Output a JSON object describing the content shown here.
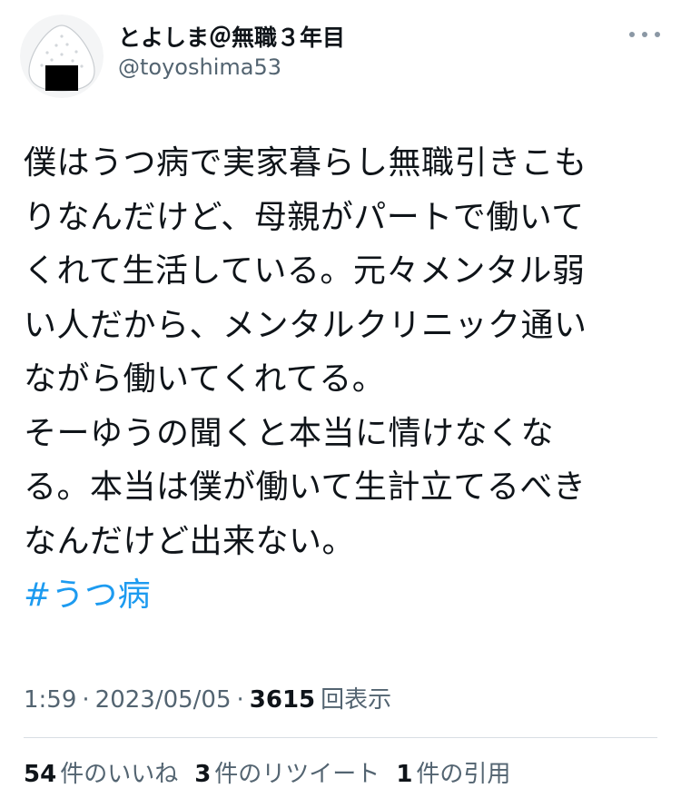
{
  "user": {
    "display_name": "とよしま＠無職３年目",
    "handle": "@toyoshima53",
    "avatar_icon": "onigiri-avatar-icon"
  },
  "tweet": {
    "lines": [
      "僕はうつ病で実家暮らし無職引きこも",
      "りなんだけど、母親がパートで働いて",
      "くれて生活している。元々メンタル弱",
      "い人だから、メンタルクリニック通い",
      "ながら働いてくれてる。",
      "そーゆうの聞くと本当に情けなくな",
      "る。本当は僕が働いて生計立てるべき",
      "なんだけど出来ない。"
    ],
    "hashtag": "#うつ病"
  },
  "meta": {
    "time": "1:59",
    "separator": "·",
    "date": "2023/05/05",
    "views_count": "3615",
    "views_label": "回表示"
  },
  "stats": {
    "likes_count": "54",
    "likes_label": "件のいいね",
    "retweets_count": "3",
    "retweets_label": "件のリツイート",
    "quotes_count": "1",
    "quotes_label": "件の引用"
  },
  "colors": {
    "text": "#0f1419",
    "secondary": "#536471",
    "link": "#1d9bf0",
    "divider": "#d8dee3"
  }
}
